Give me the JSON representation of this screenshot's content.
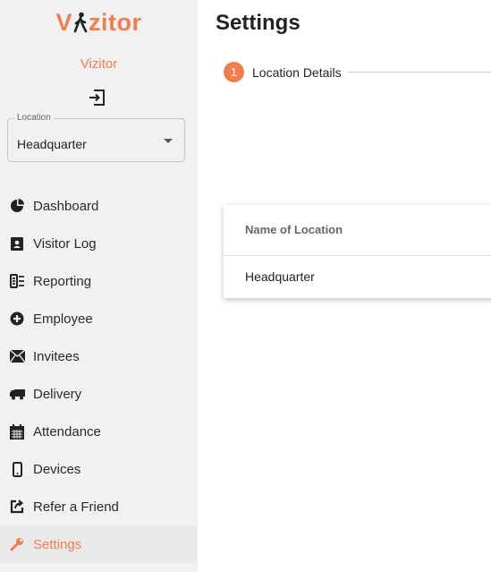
{
  "brand": {
    "logo_prefix": "V",
    "logo_suffix": "zitor",
    "app_name": "Vizitor",
    "accent": "#f07d4a"
  },
  "location": {
    "label": "Location",
    "value": "Headquarter"
  },
  "nav": {
    "items": [
      {
        "label": "Dashboard",
        "icon": "pie-chart-icon"
      },
      {
        "label": "Visitor Log",
        "icon": "contact-book-icon"
      },
      {
        "label": "Reporting",
        "icon": "report-icon"
      },
      {
        "label": "Employee",
        "icon": "plus-circle-icon"
      },
      {
        "label": "Invitees",
        "icon": "envelope-icon"
      },
      {
        "label": "Delivery",
        "icon": "truck-icon"
      },
      {
        "label": "Attendance",
        "icon": "calendar-icon"
      },
      {
        "label": "Devices",
        "icon": "phone-icon"
      },
      {
        "label": "Refer a Friend",
        "icon": "share-icon"
      },
      {
        "label": "Settings",
        "icon": "wrench-icon"
      }
    ],
    "active": "Settings"
  },
  "main": {
    "title": "Settings",
    "step": {
      "number": "1",
      "label": "Location Details"
    },
    "table": {
      "header": "Name of Location",
      "rows": [
        "Headquarter"
      ]
    }
  }
}
